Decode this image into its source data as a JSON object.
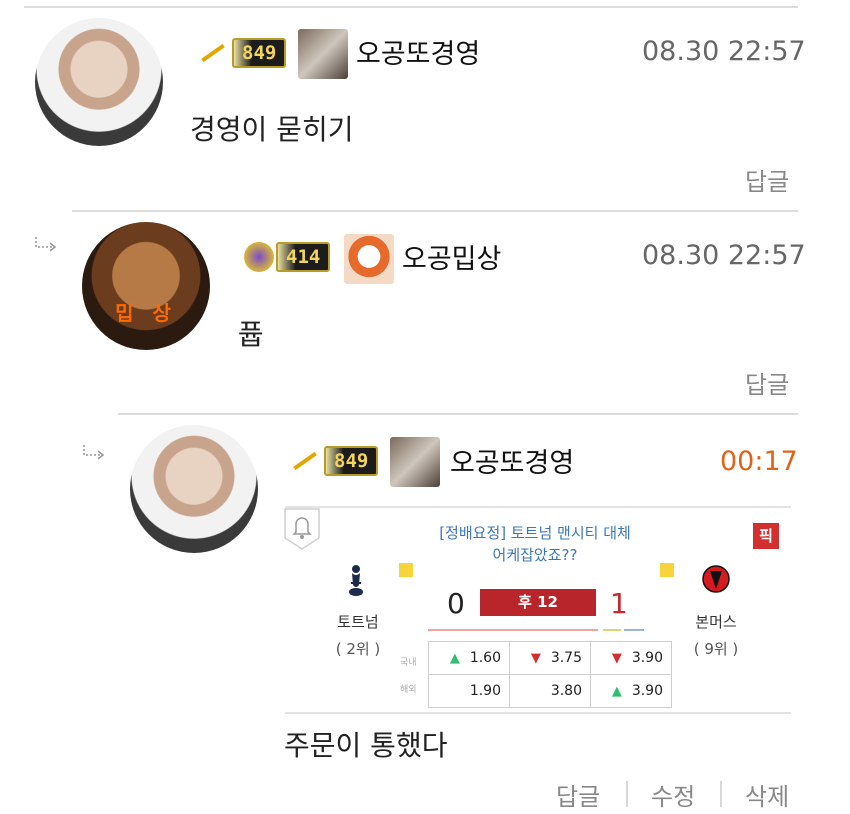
{
  "comments": [
    {
      "level": "849",
      "nickname": "오공또경영",
      "time": "08.30 22:57",
      "text": "경영이 묻히기",
      "actions": [
        "답글"
      ]
    },
    {
      "level": "414",
      "nickname": "오공밉상",
      "avatar_tag": "밉 상",
      "time": "08.30 22:57",
      "text": "퓹",
      "actions": [
        "답글"
      ]
    },
    {
      "level": "849",
      "nickname": "오공또경영",
      "time": "00:17",
      "text": "주문이 통했다",
      "actions": [
        "답글",
        "수정",
        "삭제"
      ],
      "match_card": {
        "title_line1": "[정배요정] 토트넘 맨시티 대체",
        "title_line2": "어케잡았죠??",
        "pick_badge": "픽",
        "home_team": "토트넘",
        "home_rank": "( 2위 )",
        "away_team": "본머스",
        "away_rank": "( 9위 )",
        "home_score": "0",
        "away_score": "1",
        "status": "후 12",
        "odds_rows": [
          {
            "label": "국내",
            "values": [
              "1.60",
              "3.75",
              "3.90"
            ],
            "dirs": [
              "up",
              "down",
              "down"
            ]
          },
          {
            "label": "해외",
            "values": [
              "1.90",
              "3.80",
              "3.90"
            ],
            "dirs": [
              "",
              "",
              "up"
            ]
          }
        ]
      }
    }
  ],
  "colors": {
    "divider": "#dcdcdc",
    "time_new": "#e06418",
    "status_bar": "#b8262b",
    "pick_badge": "#d32f2f",
    "link_blue": "#3b78b8"
  }
}
